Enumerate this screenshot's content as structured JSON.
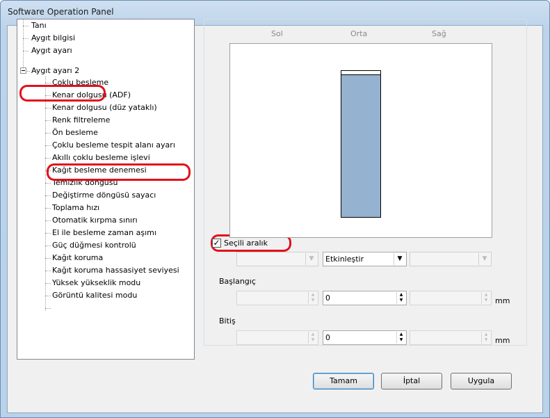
{
  "window": {
    "title": "Software Operation Panel"
  },
  "tree": {
    "items": [
      {
        "label": "Tanı"
      },
      {
        "label": "Aygıt bilgisi"
      },
      {
        "label": "Aygıt ayarı"
      },
      {
        "label": "Aygıt ayarı 2",
        "expanded": true
      },
      {
        "label": "Çoklu besleme"
      },
      {
        "label": "Kenar dolgusu (ADF)"
      },
      {
        "label": "Kenar dolgusu (düz yataklı)"
      },
      {
        "label": "Renk filtreleme"
      },
      {
        "label": "Ön besleme"
      },
      {
        "label": "Çoklu besleme tespit alanı ayarı",
        "selected": true
      },
      {
        "label": "Akıllı çoklu besleme işlevi"
      },
      {
        "label": "Kağıt besleme denemesi"
      },
      {
        "label": "Temizlik döngüsü"
      },
      {
        "label": "Değiştirme döngüsü sayacı"
      },
      {
        "label": "Toplama hızı"
      },
      {
        "label": "Otomatik kırpma sınırı"
      },
      {
        "label": "El ile besleme zaman aşımı"
      },
      {
        "label": "Güç düğmesi kontrolü"
      },
      {
        "label": "Kağıt koruma"
      },
      {
        "label": "Kağıt koruma hassasiyet seviyesi"
      },
      {
        "label": "Yüksek yükseklik modu"
      },
      {
        "label": "Görüntü kalitesi modu"
      }
    ]
  },
  "graph": {
    "columns": [
      "Sol",
      "Orta",
      "Sağ"
    ],
    "bar_color": "#95b2d1"
  },
  "selection": {
    "checkbox_label": "Seçili aralık",
    "checked": true,
    "left_combo": "",
    "middle_combo": "Etkinleştir",
    "right_combo": ""
  },
  "start": {
    "label": "Başlangıç",
    "left": "",
    "middle": "0",
    "right": "",
    "unit": "mm"
  },
  "end": {
    "label": "Bitiş",
    "left": "",
    "middle": "0",
    "right": "",
    "unit": "mm"
  },
  "buttons": {
    "ok": "Tamam",
    "cancel": "İptal",
    "apply": "Uygula"
  },
  "colors": {
    "highlight": "#e3101a",
    "accent": "#3c7fb1"
  }
}
